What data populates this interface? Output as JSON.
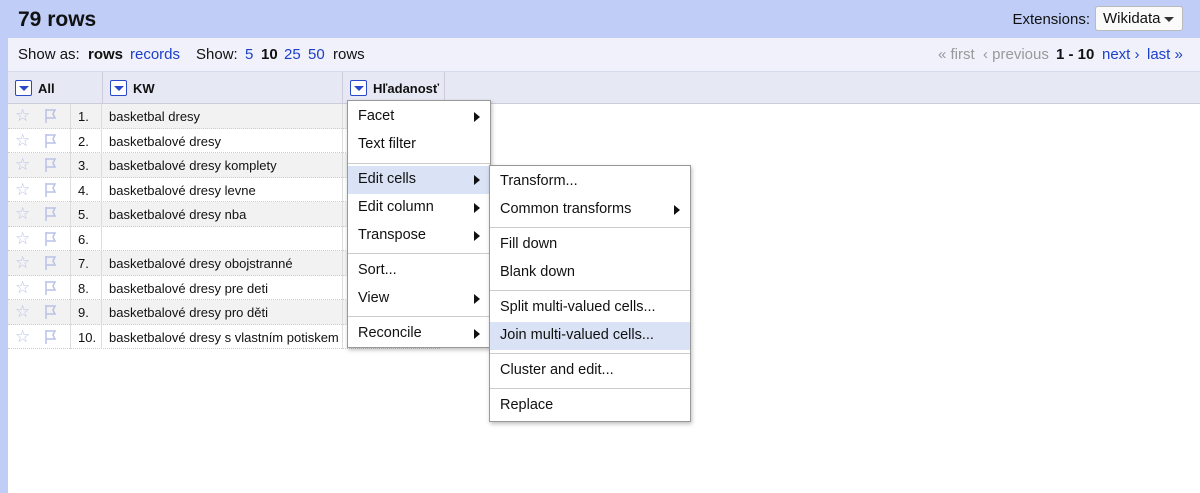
{
  "header": {
    "row_count": "79 rows",
    "extensions_label": "Extensions:",
    "extensions_button": "Wikidata"
  },
  "viewbar": {
    "show_as": "Show as:",
    "rows": "rows",
    "records": "records",
    "show": "Show:",
    "sizes": [
      "5",
      "10",
      "25",
      "50"
    ],
    "rows_suffix": "rows",
    "first": "« first",
    "previous": "‹ previous",
    "range": "1 - 10",
    "next": "next ›",
    "last": "last »"
  },
  "columns": {
    "all": "All",
    "kw": "KW",
    "hladanost": "Hľadanosť"
  },
  "table_rows": [
    {
      "num": "1.",
      "kw": "basketbal dresy"
    },
    {
      "num": "2.",
      "kw": "basketbalové dresy"
    },
    {
      "num": "3.",
      "kw": "basketbalové dresy komplety"
    },
    {
      "num": "4.",
      "kw": "basketbalové dresy levne"
    },
    {
      "num": "5.",
      "kw": "basketbalové dresy nba"
    },
    {
      "num": "6.",
      "kw": ""
    },
    {
      "num": "7.",
      "kw": "basketbalové dresy obojstranné"
    },
    {
      "num": "8.",
      "kw": "basketbalové dresy pre deti"
    },
    {
      "num": "9.",
      "kw": "basketbalové dresy pro děti"
    },
    {
      "num": "10.",
      "kw": "basketbalové dresy s vlastním potiskem"
    }
  ],
  "column_menu": {
    "facet": "Facet",
    "text_filter": "Text filter",
    "edit_cells": "Edit cells",
    "edit_column": "Edit column",
    "transpose": "Transpose",
    "sort": "Sort...",
    "view": "View",
    "reconcile": "Reconcile"
  },
  "edit_cells_menu": {
    "transform": "Transform...",
    "common_transforms": "Common transforms",
    "fill_down": "Fill down",
    "blank_down": "Blank down",
    "split": "Split multi-valued cells...",
    "join": "Join multi-valued cells...",
    "cluster": "Cluster and edit...",
    "replace": "Replace"
  }
}
